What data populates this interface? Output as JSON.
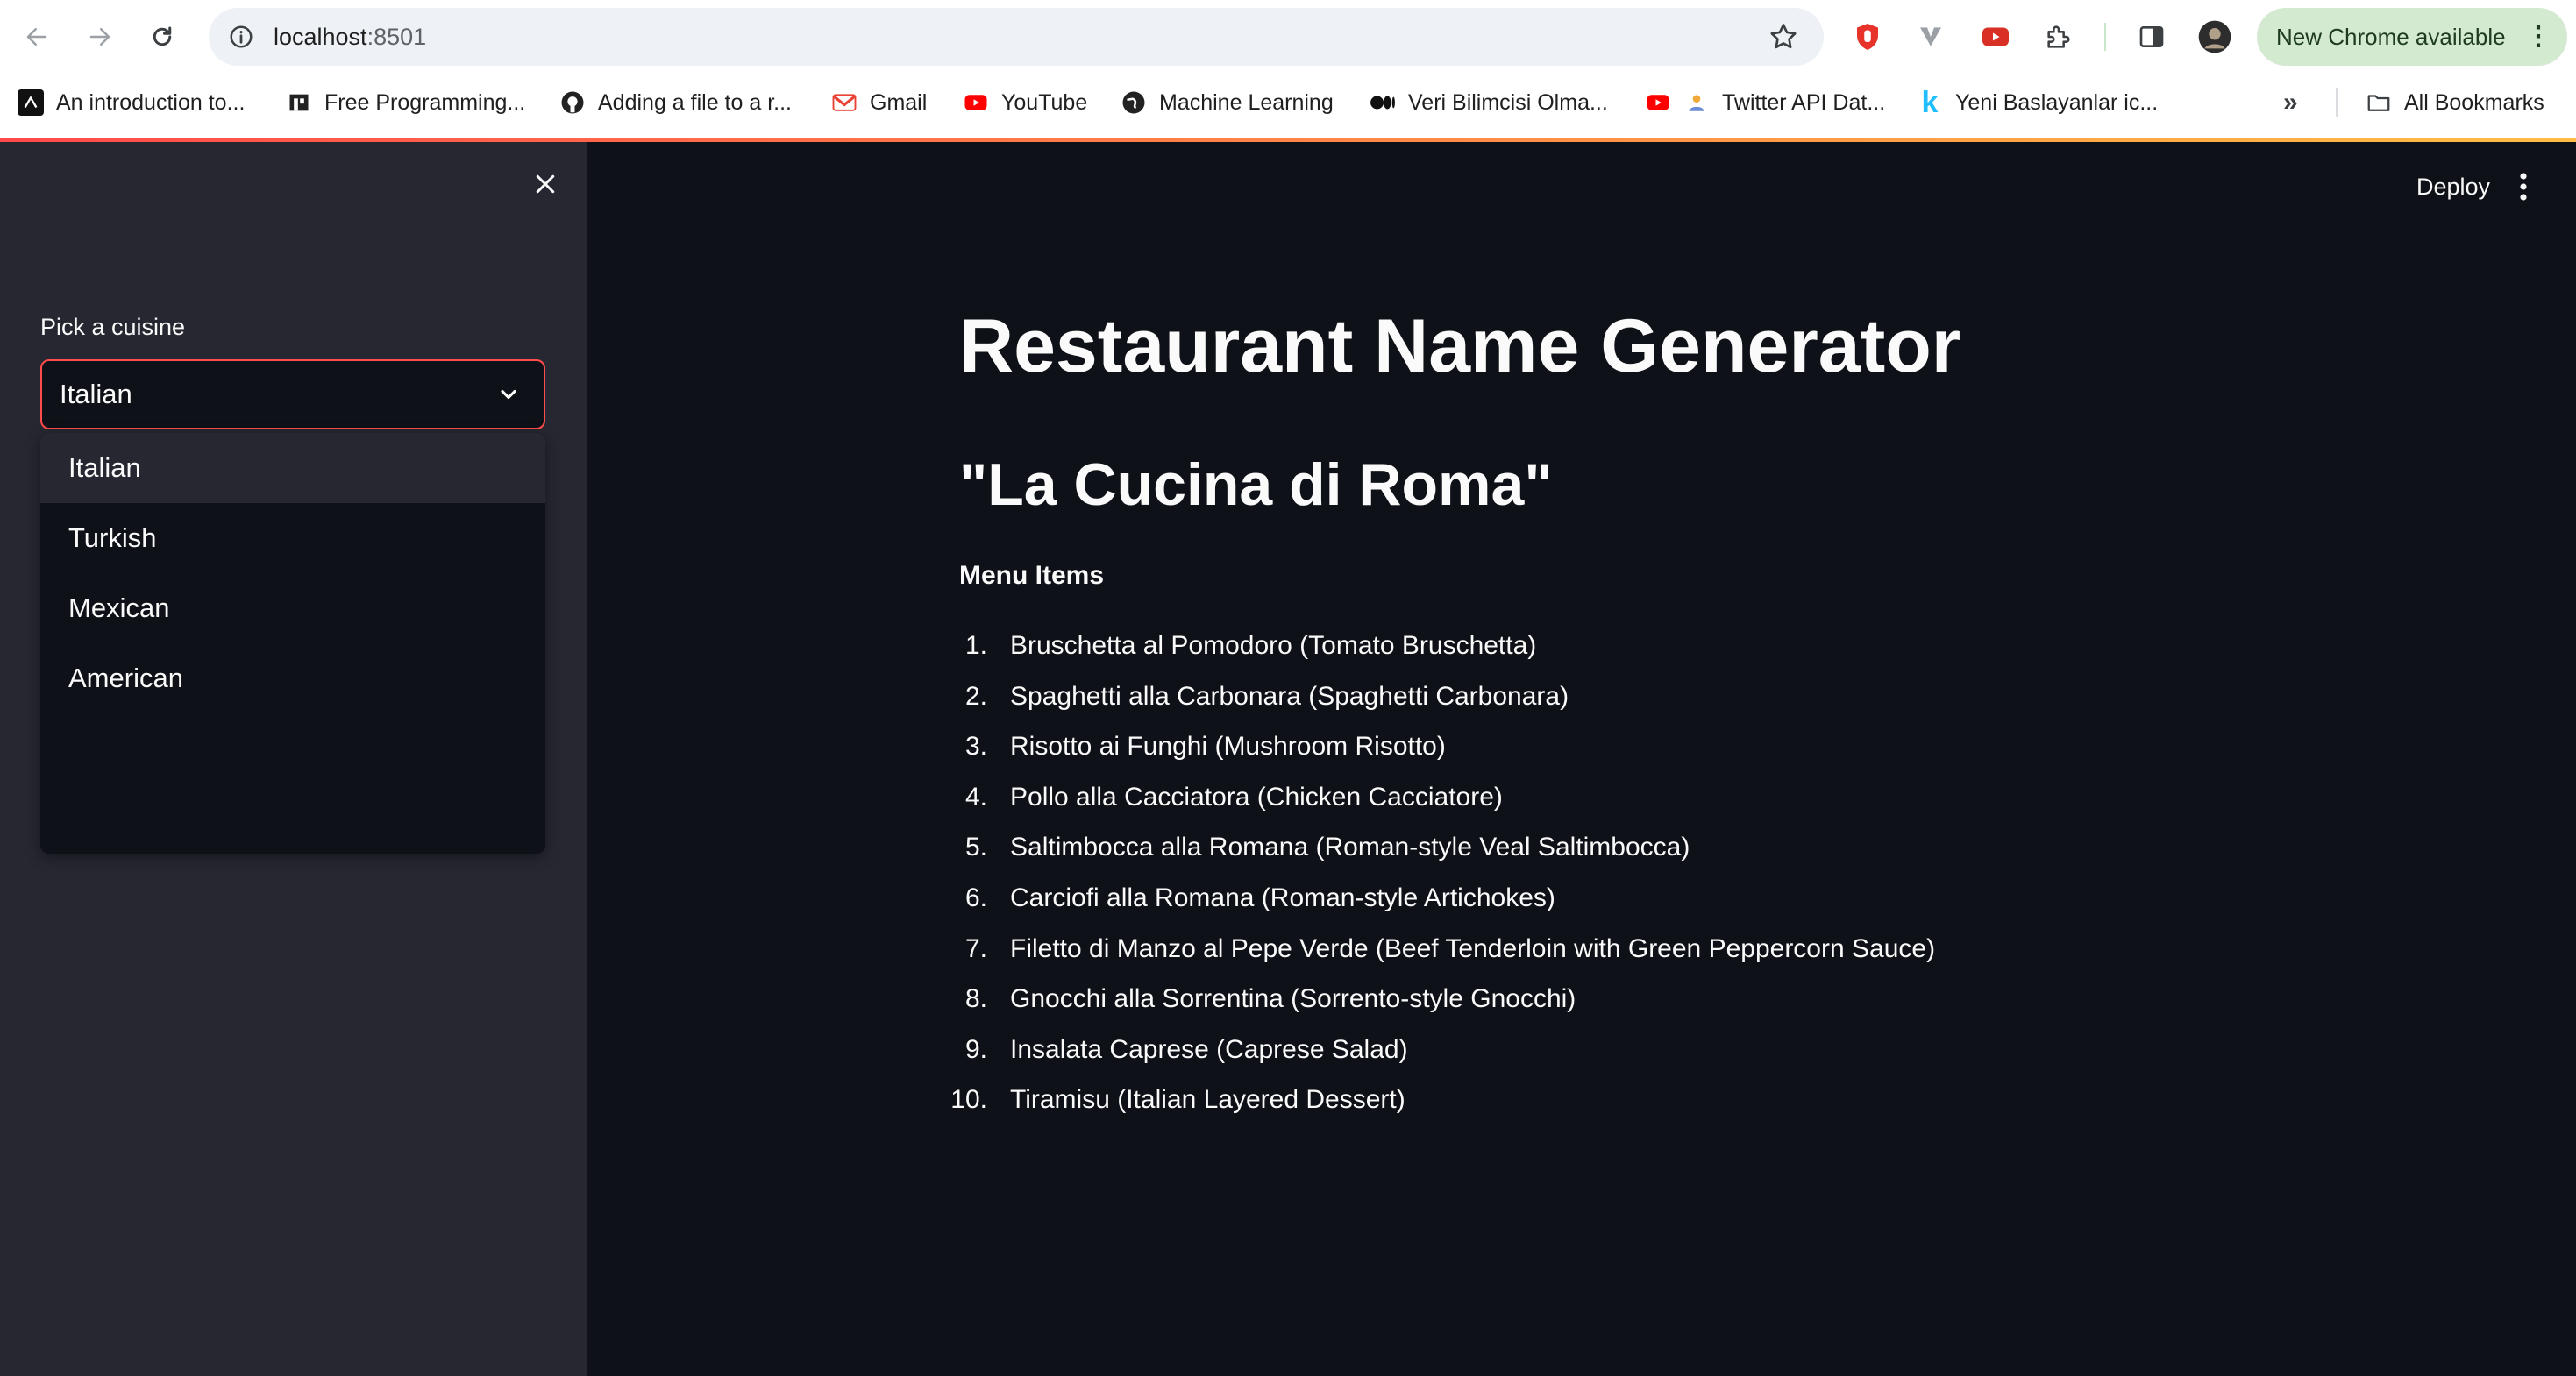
{
  "browser": {
    "url_host": "localhost",
    "url_port": ":8501",
    "update_pill": "New Chrome available",
    "bookmarks": [
      {
        "label": "An introduction to...",
        "icon": "dark-logo-icon"
      },
      {
        "label": "Free Programming...",
        "icon": "building-icon"
      },
      {
        "label": "Adding a file to a r...",
        "icon": "github-icon"
      },
      {
        "label": "Gmail",
        "icon": "gmail-icon"
      },
      {
        "label": "YouTube",
        "icon": "youtube-icon"
      },
      {
        "label": "Machine Learning",
        "icon": "globe-icon"
      },
      {
        "label": "Veri Bilimcisi Olma...",
        "icon": "medium-icon"
      },
      {
        "label": "Twitter API Dat...",
        "icon": "youtube-icon"
      },
      {
        "label": "Yeni Baslayanlar ic...",
        "icon": "k-icon"
      }
    ],
    "all_bookmarks": "All Bookmarks"
  },
  "colors": {
    "accent": "#ff4b4b",
    "sidebar_bg": "#262730",
    "main_bg": "#0e1117",
    "text": "#fafafa"
  },
  "app": {
    "deploy": "Deploy",
    "sidebar": {
      "select_label": "Pick a cuisine",
      "selected_value": "Italian",
      "options": [
        "Italian",
        "Turkish",
        "Mexican",
        "American"
      ]
    },
    "title": "Restaurant Name Generator",
    "restaurant_name": "\"La Cucina di Roma\"",
    "menu_heading": "Menu Items",
    "menu_items": [
      {
        "num": "1.",
        "text": "Bruschetta al Pomodoro (Tomato Bruschetta)"
      },
      {
        "num": "2.",
        "text": "Spaghetti alla Carbonara (Spaghetti Carbonara)"
      },
      {
        "num": "3.",
        "text": "Risotto ai Funghi (Mushroom Risotto)"
      },
      {
        "num": "4.",
        "text": "Pollo alla Cacciatora (Chicken Cacciatore)"
      },
      {
        "num": "5.",
        "text": "Saltimbocca alla Romana (Roman-style Veal Saltimbocca)"
      },
      {
        "num": "6.",
        "text": "Carciofi alla Romana (Roman-style Artichokes)"
      },
      {
        "num": "7.",
        "text": "Filetto di Manzo al Pepe Verde (Beef Tenderloin with Green Peppercorn Sauce)"
      },
      {
        "num": "8.",
        "text": "Gnocchi alla Sorrentina (Sorrento-style Gnocchi)"
      },
      {
        "num": "9.",
        "text": "Insalata Caprese (Caprese Salad)"
      },
      {
        "num": "10.",
        "text": "Tiramisu (Italian Layered Dessert)"
      }
    ]
  }
}
